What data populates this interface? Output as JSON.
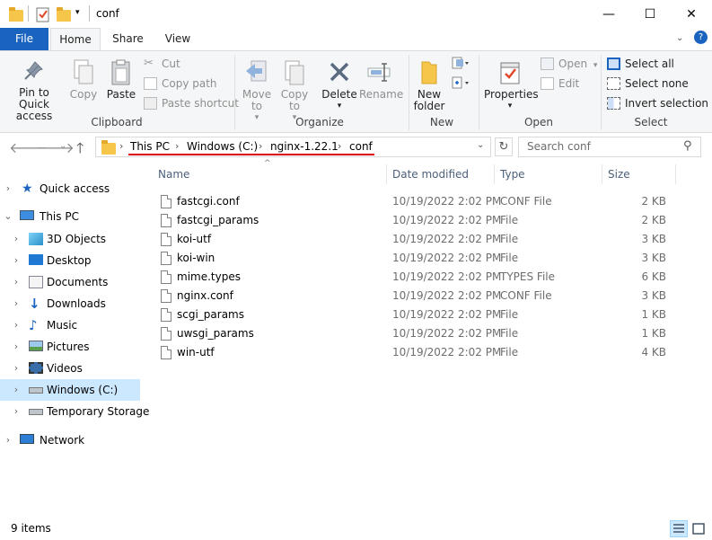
{
  "window": {
    "title": "conf",
    "controls": {
      "minimize": "—",
      "maximize": "☐",
      "close": "✕"
    }
  },
  "ribbon_tabs": [
    {
      "label": "File"
    },
    {
      "label": "Home"
    },
    {
      "label": "Share"
    },
    {
      "label": "View"
    }
  ],
  "ribbon": {
    "clipboard": {
      "pin_label": "Pin to Quick access",
      "copy_label": "Copy",
      "paste_label": "Paste",
      "cut_label": "Cut",
      "copy_path_label": "Copy path",
      "paste_shortcut_label": "Paste shortcut",
      "group_label": "Clipboard"
    },
    "organize": {
      "move_to_label": "Move to",
      "copy_to_label": "Copy to",
      "delete_label": "Delete",
      "rename_label": "Rename",
      "group_label": "Organize"
    },
    "new": {
      "new_folder_label": "New folder",
      "group_label": "New"
    },
    "open": {
      "properties_label": "Properties",
      "open_label": "Open",
      "edit_label": "Edit",
      "group_label": "Open"
    },
    "select": {
      "select_all_label": "Select all",
      "select_none_label": "Select none",
      "invert_label": "Invert selection",
      "group_label": "Select"
    }
  },
  "address": {
    "crumbs": [
      "This PC",
      "Windows (C:)",
      "nginx-1.22.1",
      "conf"
    ],
    "annotation_color": "#e00000"
  },
  "search": {
    "placeholder": "Search conf"
  },
  "nav_tree": [
    {
      "label": "Quick access",
      "icon": "star-icon"
    },
    {
      "label": "This PC",
      "icon": "computer-icon"
    },
    {
      "label": "3D Objects",
      "icon": "cube-icon"
    },
    {
      "label": "Desktop",
      "icon": "desktop-icon"
    },
    {
      "label": "Documents",
      "icon": "documents-icon"
    },
    {
      "label": "Downloads",
      "icon": "download-icon"
    },
    {
      "label": "Music",
      "icon": "music-icon"
    },
    {
      "label": "Pictures",
      "icon": "pictures-icon"
    },
    {
      "label": "Videos",
      "icon": "videos-icon"
    },
    {
      "label": "Windows (C:)",
      "icon": "drive-icon"
    },
    {
      "label": "Temporary Storage",
      "icon": "drive-icon"
    },
    {
      "label": "Network",
      "icon": "network-icon"
    }
  ],
  "columns": {
    "name": "Name",
    "date": "Date modified",
    "type": "Type",
    "size": "Size"
  },
  "files": [
    {
      "name": "fastcgi.conf",
      "date": "10/19/2022 2:02 PM",
      "type": "CONF File",
      "size": "2 KB"
    },
    {
      "name": "fastcgi_params",
      "date": "10/19/2022 2:02 PM",
      "type": "File",
      "size": "2 KB"
    },
    {
      "name": "koi-utf",
      "date": "10/19/2022 2:02 PM",
      "type": "File",
      "size": "3 KB"
    },
    {
      "name": "koi-win",
      "date": "10/19/2022 2:02 PM",
      "type": "File",
      "size": "3 KB"
    },
    {
      "name": "mime.types",
      "date": "10/19/2022 2:02 PM",
      "type": "TYPES File",
      "size": "6 KB"
    },
    {
      "name": "nginx.conf",
      "date": "10/19/2022 2:02 PM",
      "type": "CONF File",
      "size": "3 KB"
    },
    {
      "name": "scgi_params",
      "date": "10/19/2022 2:02 PM",
      "type": "File",
      "size": "1 KB"
    },
    {
      "name": "uwsgi_params",
      "date": "10/19/2022 2:02 PM",
      "type": "File",
      "size": "1 KB"
    },
    {
      "name": "win-utf",
      "date": "10/19/2022 2:02 PM",
      "type": "File",
      "size": "4 KB"
    }
  ],
  "status": {
    "item_count": "9 items"
  },
  "colors": {
    "accent": "#1a64c0",
    "selection": "#cce8ff",
    "folder": "#f6c64b"
  }
}
